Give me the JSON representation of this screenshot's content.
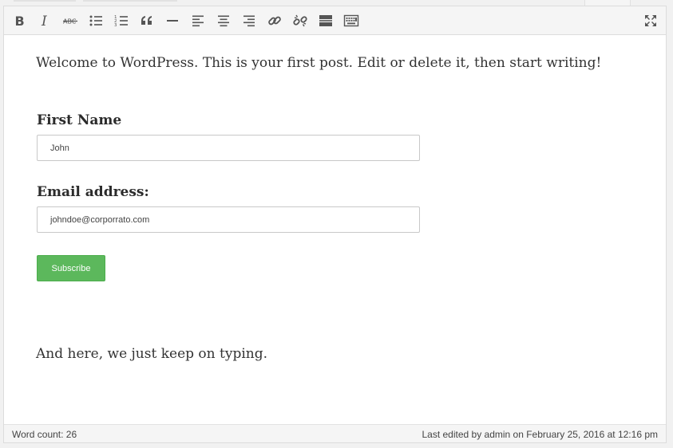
{
  "toolbar": {
    "buttons": [
      {
        "name": "bold",
        "icon": "bold-icon"
      },
      {
        "name": "italic",
        "icon": "italic-icon"
      },
      {
        "name": "strikethrough",
        "icon": "strikethrough-icon",
        "glyph": "ABC"
      },
      {
        "name": "bulleted-list",
        "icon": "bulleted-list-icon"
      },
      {
        "name": "numbered-list",
        "icon": "numbered-list-icon"
      },
      {
        "name": "blockquote",
        "icon": "blockquote-icon"
      },
      {
        "name": "horizontal-line",
        "icon": "horizontal-line-icon"
      },
      {
        "name": "align-left",
        "icon": "align-left-icon"
      },
      {
        "name": "align-center",
        "icon": "align-center-icon"
      },
      {
        "name": "align-right",
        "icon": "align-right-icon"
      },
      {
        "name": "insert-link",
        "icon": "link-icon"
      },
      {
        "name": "remove-link",
        "icon": "unlink-icon"
      },
      {
        "name": "read-more",
        "icon": "read-more-icon"
      },
      {
        "name": "toolbar-toggle",
        "icon": "keyboard-icon"
      }
    ],
    "fullscreen_icon": "fullscreen-icon"
  },
  "content": {
    "intro": "Welcome to WordPress. This is your first post. Edit or delete it, then start writing!",
    "form": {
      "first_name_label": "First Name",
      "first_name_value": "John",
      "email_label": "Email address:",
      "email_value": "johndoe@corporrato.com",
      "subscribe_label": "Subscribe"
    },
    "outro": "And here, we just keep on typing."
  },
  "status": {
    "word_count": "Word count: 26",
    "last_edited": "Last edited by admin on February 25, 2016 at 12:16 pm"
  },
  "colors": {
    "subscribe_bg": "#5cb85c",
    "icon_color": "#555555"
  }
}
